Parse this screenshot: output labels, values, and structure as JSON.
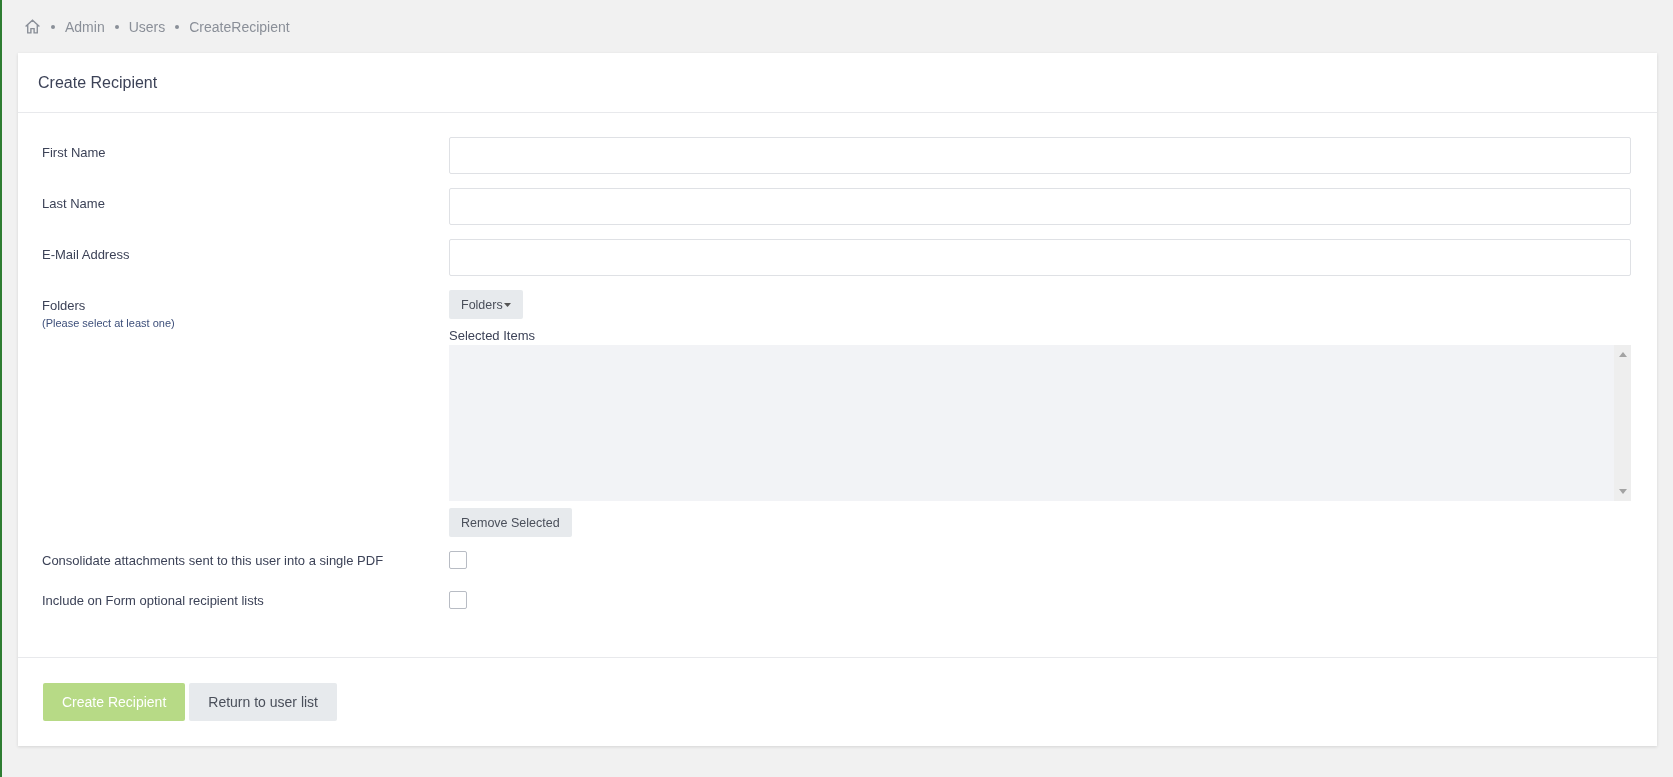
{
  "breadcrumb": [
    "Admin",
    "Users",
    "CreateRecipient"
  ],
  "card": {
    "title": "Create Recipient",
    "text_fields": [
      {
        "label": "First Name"
      },
      {
        "label": "Last Name"
      },
      {
        "label": "E-Mail Address"
      }
    ],
    "folders": {
      "label": "Folders",
      "hint": "(Please select at least one)",
      "dropdown": "Folders",
      "selected_label": "Selected Items",
      "remove_button": "Remove Selected"
    },
    "checkboxes": [
      {
        "label": "Consolidate attachments sent to this user into a single PDF",
        "checked": false
      },
      {
        "label": "Include on Form optional recipient lists",
        "checked": false
      }
    ],
    "buttons": [
      {
        "label": "Create Recipient",
        "kind": "primary",
        "disabled": true
      },
      {
        "label": "Return to user list",
        "kind": "secondary",
        "disabled": false
      }
    ]
  }
}
